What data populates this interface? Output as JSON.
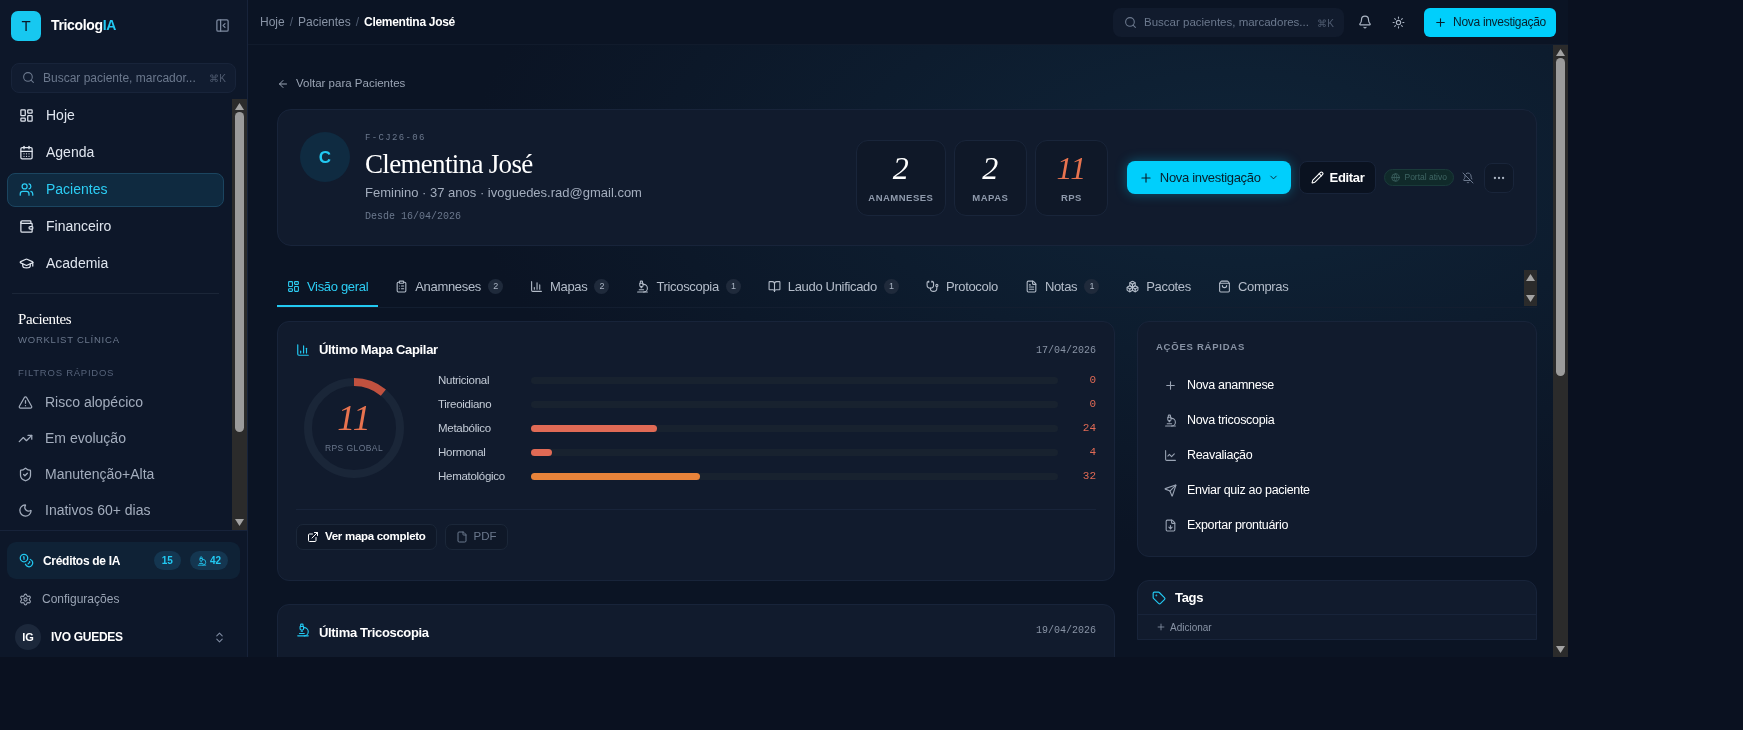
{
  "sidebar": {
    "logo_letter": "T",
    "brand": "Tricolog",
    "brand_accent": "IA",
    "search": {
      "placeholder": "Buscar paciente, marcador...",
      "shortcut": "⌘K"
    },
    "nav": [
      {
        "label": "Hoje",
        "selected": false
      },
      {
        "label": "Agenda",
        "selected": false
      },
      {
        "label": "Pacientes",
        "selected": true
      },
      {
        "label": "Financeiro",
        "selected": false
      },
      {
        "label": "Academia",
        "selected": false
      }
    ],
    "section_title": "Pacientes",
    "section_subtitle": "WORKLIST CLÍNICA",
    "filters_title": "FILTROS RÁPIDOS",
    "filters": [
      "Risco alopécico",
      "Em evolução",
      "Manutenção+Alta",
      "Inativos 60+ dias"
    ],
    "credits": {
      "label": "Créditos de IA",
      "count_a": "15",
      "count_b": "42"
    },
    "settings": "Configurações",
    "user": {
      "initials": "IG",
      "name": "IVO GUEDES"
    }
  },
  "header": {
    "breadcrumb": [
      "Hoje",
      "Pacientes",
      "Clementina José"
    ],
    "separator": "/",
    "search": {
      "placeholder": "Buscar pacientes, marcadores...",
      "shortcut": "⌘K"
    },
    "new_button": "Nova investigação"
  },
  "back_link": "Voltar para Pacientes",
  "patient": {
    "initial": "C",
    "code": "F-CJ26-06",
    "name": "Clementina José",
    "details": "Feminino · 37 anos · ivoguedes.rad@gmail.com",
    "since": "Desde 16/04/2026",
    "stats": [
      {
        "value": "2",
        "label": "ANAMNESES",
        "color": "#ffffff"
      },
      {
        "value": "2",
        "label": "MAPAS",
        "color": "#ffffff"
      },
      {
        "value": "11",
        "label": "RPS",
        "color": "#e8734f"
      }
    ],
    "new_button": "Nova investigação",
    "edit_button": "Editar",
    "portal": "Portal ativo"
  },
  "tabs": [
    {
      "label": "Visão geral",
      "selected": true
    },
    {
      "label": "Anamneses",
      "count": "2",
      "selected": false
    },
    {
      "label": "Mapas",
      "count": "2",
      "selected": false
    },
    {
      "label": "Tricoscopia",
      "count": "1",
      "selected": false
    },
    {
      "label": "Laudo Unificado",
      "count": "1",
      "selected": false
    },
    {
      "label": "Protocolo",
      "selected": false
    },
    {
      "label": "Notas",
      "count": "1",
      "selected": false
    },
    {
      "label": "Pacotes",
      "selected": false
    },
    {
      "label": "Compras",
      "selected": false
    }
  ],
  "map_card": {
    "title": "Último Mapa Capilar",
    "date": "17/04/2026",
    "gauge": {
      "value": "11",
      "label": "RPS GLOBAL",
      "level": 0.11
    },
    "axes": [
      {
        "name": "Nutricional",
        "reading": "0"
      },
      {
        "name": "Tireoidiano",
        "reading": "0"
      },
      {
        "name": "Metabólico",
        "level": 0.24,
        "reading": "24",
        "color": "#e06a55"
      },
      {
        "name": "Hormonal",
        "level": 0.04,
        "reading": "4",
        "color": "#e06a55"
      },
      {
        "name": "Hematológico",
        "level": 0.32,
        "reading": "32",
        "color": "#e8833a"
      }
    ],
    "view_button": "Ver mapa completo",
    "pdf_button": "PDF"
  },
  "trico_card": {
    "title": "Última Tricoscopia",
    "date": "19/04/2026"
  },
  "quick_actions": {
    "title": "AÇÕES RÁPIDAS",
    "items": [
      "Nova anamnese",
      "Nova tricoscopia",
      "Reavaliação",
      "Enviar quiz ao paciente",
      "Exportar prontuário"
    ]
  },
  "tags": {
    "title": "Tags",
    "add": "Adicionar"
  }
}
